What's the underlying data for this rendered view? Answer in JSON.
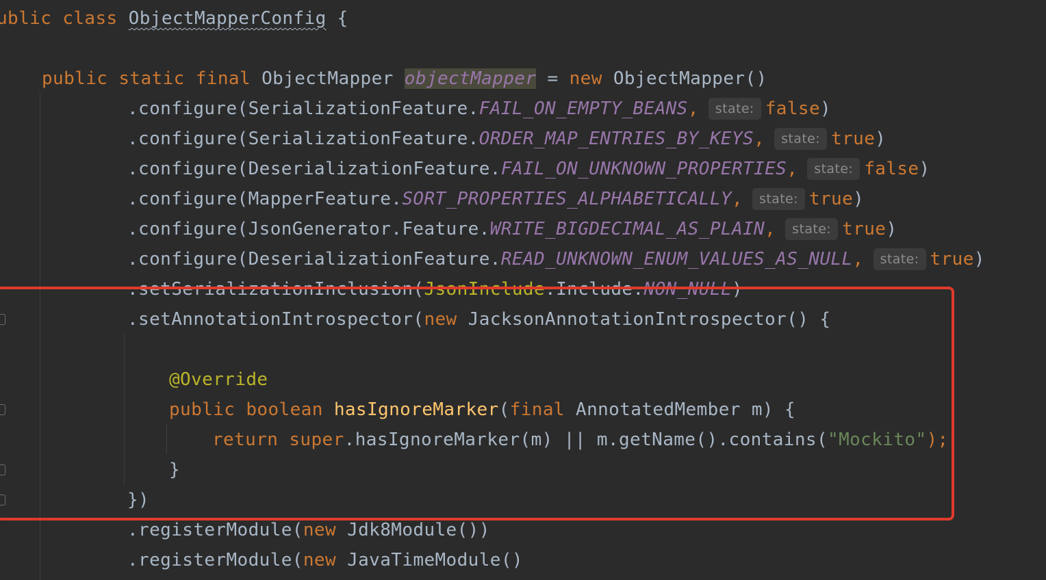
{
  "editor": {
    "accent_color": "#e03a2c",
    "lines": [
      {
        "tokens": [
          {
            "t": "ublic ",
            "c": "kw"
          },
          {
            "t": "class ",
            "c": "kw"
          },
          {
            "t": "ObjectMapperConfig",
            "c": "plain wavy"
          },
          {
            "t": " {",
            "c": "plain"
          }
        ]
      },
      {
        "tokens": []
      },
      {
        "tokens": [
          {
            "t": "public ",
            "c": "kw"
          },
          {
            "t": "static ",
            "c": "kw"
          },
          {
            "t": "final ",
            "c": "kw"
          },
          {
            "t": "ObjectMapper ",
            "c": "plain"
          },
          {
            "t": "objectMapper",
            "c": "field hl"
          },
          {
            "t": " = ",
            "c": "plain"
          },
          {
            "t": "new ",
            "c": "kw"
          },
          {
            "t": "ObjectMapper()",
            "c": "plain"
          }
        ]
      },
      {
        "tokens": [
          {
            "t": ".configure(SerializationFeature.",
            "c": "plain"
          },
          {
            "t": "FAIL_ON_EMPTY_BEANS",
            "c": "field"
          },
          {
            "t": ",",
            "c": "kw"
          },
          {
            "t": "state:",
            "c": "hint"
          },
          {
            "t": "false",
            "c": "kw"
          },
          {
            "t": ")",
            "c": "plain"
          }
        ]
      },
      {
        "tokens": [
          {
            "t": ".configure(SerializationFeature.",
            "c": "plain"
          },
          {
            "t": "ORDER_MAP_ENTRIES_BY_KEYS",
            "c": "field"
          },
          {
            "t": ",",
            "c": "kw"
          },
          {
            "t": "state:",
            "c": "hint"
          },
          {
            "t": "true",
            "c": "kw"
          },
          {
            "t": ")",
            "c": "plain"
          }
        ]
      },
      {
        "tokens": [
          {
            "t": ".configure(DeserializationFeature.",
            "c": "plain"
          },
          {
            "t": "FAIL_ON_UNKNOWN_PROPERTIES",
            "c": "field"
          },
          {
            "t": ",",
            "c": "kw"
          },
          {
            "t": "state:",
            "c": "hint"
          },
          {
            "t": "false",
            "c": "kw"
          },
          {
            "t": ")",
            "c": "plain"
          }
        ]
      },
      {
        "tokens": [
          {
            "t": ".configure(MapperFeature.",
            "c": "plain"
          },
          {
            "t": "SORT_PROPERTIES_ALPHABETICALLY",
            "c": "field"
          },
          {
            "t": ",",
            "c": "kw"
          },
          {
            "t": "state:",
            "c": "hint"
          },
          {
            "t": "true",
            "c": "kw"
          },
          {
            "t": ")",
            "c": "plain"
          }
        ]
      },
      {
        "tokens": [
          {
            "t": ".configure(JsonGenerator.Feature.",
            "c": "plain"
          },
          {
            "t": "WRITE_BIGDECIMAL_AS_PLAIN",
            "c": "field"
          },
          {
            "t": ",",
            "c": "kw"
          },
          {
            "t": "state:",
            "c": "hint"
          },
          {
            "t": "true",
            "c": "kw"
          },
          {
            "t": ")",
            "c": "plain"
          }
        ]
      },
      {
        "tokens": [
          {
            "t": ".configure(DeserializationFeature.",
            "c": "plain"
          },
          {
            "t": "READ_UNKNOWN_ENUM_VALUES_AS_NULL",
            "c": "field"
          },
          {
            "t": ",",
            "c": "kw"
          },
          {
            "t": "state:",
            "c": "hint"
          },
          {
            "t": "true",
            "c": "kw"
          },
          {
            "t": ")",
            "c": "plain"
          }
        ]
      },
      {
        "tokens": [
          {
            "t": ".setSerializationInclusion(",
            "c": "plain"
          },
          {
            "t": "JsonInclude",
            "c": "ann"
          },
          {
            "t": ".Include.",
            "c": "plain"
          },
          {
            "t": "NON_NULL",
            "c": "field"
          },
          {
            "t": ")",
            "c": "plain"
          }
        ]
      },
      {
        "tokens": [
          {
            "t": ".setAnnotationIntrospector(",
            "c": "plain"
          },
          {
            "t": "new ",
            "c": "kw"
          },
          {
            "t": "JacksonAnnotationIntrospector() {",
            "c": "plain"
          }
        ]
      },
      {
        "tokens": []
      },
      {
        "tokens": [
          {
            "t": "@Override",
            "c": "ann"
          }
        ]
      },
      {
        "tokens": [
          {
            "t": "public ",
            "c": "kw"
          },
          {
            "t": "boolean ",
            "c": "kw"
          },
          {
            "t": "hasIgnoreMarker",
            "c": "method"
          },
          {
            "t": "(",
            "c": "plain"
          },
          {
            "t": "final ",
            "c": "kw"
          },
          {
            "t": "AnnotatedMember m) {",
            "c": "plain"
          }
        ]
      },
      {
        "tokens": [
          {
            "t": "return ",
            "c": "kw"
          },
          {
            "t": "super",
            "c": "kw"
          },
          {
            "t": ".hasIgnoreMarker(m) || m.getName().contains(",
            "c": "plain"
          },
          {
            "t": "\"Mockito\"",
            "c": "str"
          },
          {
            "t": ");",
            "c": "kw"
          }
        ]
      },
      {
        "tokens": [
          {
            "t": "}",
            "c": "plain"
          }
        ]
      },
      {
        "tokens": [
          {
            "t": "})",
            "c": "plain"
          }
        ]
      },
      {
        "tokens": [
          {
            "t": ".registerModule(",
            "c": "plain"
          },
          {
            "t": "new ",
            "c": "kw"
          },
          {
            "t": "Jdk8Module())",
            "c": "plain"
          }
        ]
      },
      {
        "tokens": [
          {
            "t": ".registerModule(",
            "c": "plain"
          },
          {
            "t": "new ",
            "c": "kw"
          },
          {
            "t": "JavaTimeModule()",
            "c": "plain"
          }
        ]
      }
    ]
  }
}
